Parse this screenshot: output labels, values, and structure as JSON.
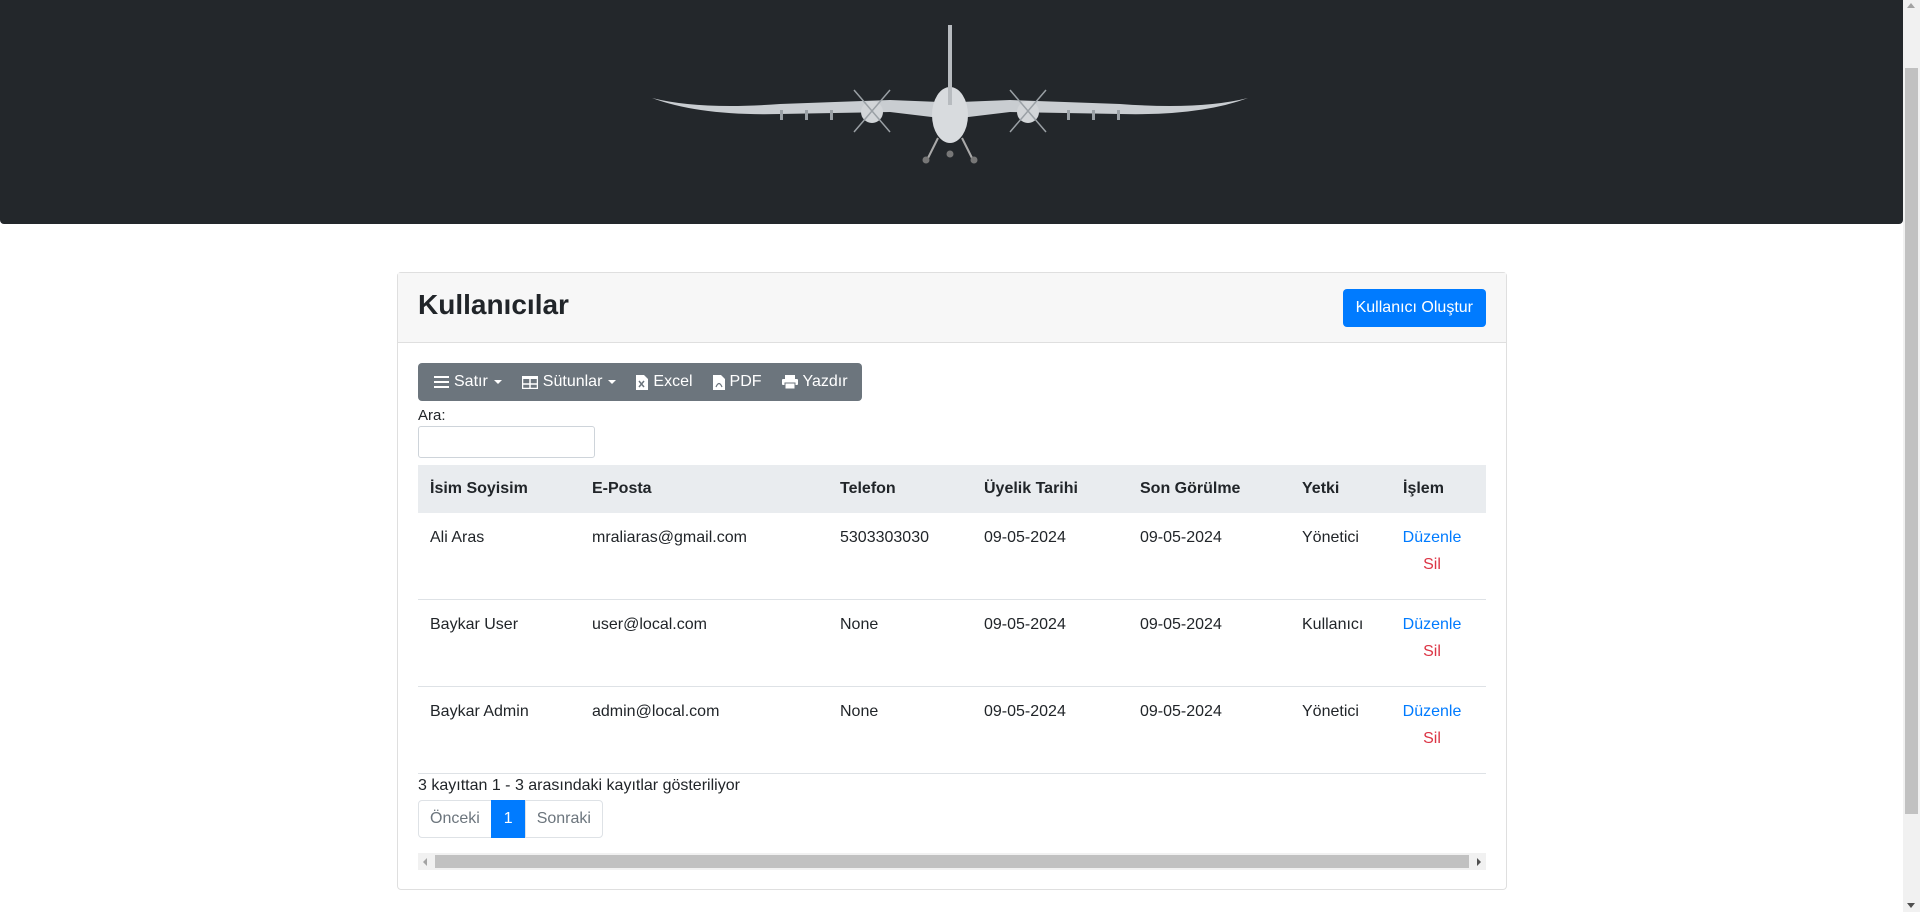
{
  "banner": {
    "image": "drone-aircraft"
  },
  "card": {
    "title": "Kullanıcılar",
    "create_button": "Kullanıcı Oluştur"
  },
  "toolbar": {
    "items": [
      {
        "label": "Satır",
        "icon": "list-icon"
      },
      {
        "label": "Sütunlar",
        "icon": "table-icon"
      },
      {
        "label": "Excel",
        "icon": "excel-file-icon"
      },
      {
        "label": "PDF",
        "icon": "pdf-file-icon"
      },
      {
        "label": "Yazdır",
        "icon": "printer-icon"
      }
    ]
  },
  "search": {
    "label": "Ara:",
    "value": ""
  },
  "table": {
    "headers": [
      "İsim Soyisim",
      "E-Posta",
      "Telefon",
      "Üyelik Tarihi",
      "Son Görülme",
      "Yetki",
      "İşlem"
    ],
    "rows": [
      {
        "name": "Ali Aras",
        "email": "mraliaras@gmail.com",
        "phone": "5303303030",
        "joined": "09-05-2024",
        "last_seen": "09-05-2024",
        "role": "Yönetici",
        "edit": "Düzenle",
        "delete": "Sil"
      },
      {
        "name": "Baykar User",
        "email": "user@local.com",
        "phone": "None",
        "joined": "09-05-2024",
        "last_seen": "09-05-2024",
        "role": "Kullanıcı",
        "edit": "Düzenle",
        "delete": "Sil"
      },
      {
        "name": "Baykar Admin",
        "email": "admin@local.com",
        "phone": "None",
        "joined": "09-05-2024",
        "last_seen": "09-05-2024",
        "role": "Yönetici",
        "edit": "Düzenle",
        "delete": "Sil"
      }
    ]
  },
  "info": "3 kayıttan 1 - 3 arasındaki kayıtlar gösteriliyor",
  "pagination": {
    "prev": "Önceki",
    "current": "1",
    "next": "Sonraki"
  },
  "colors": {
    "primary": "#007bff",
    "danger": "#dc3545",
    "toolbar": "#6c757d",
    "banner": "#23272b"
  }
}
